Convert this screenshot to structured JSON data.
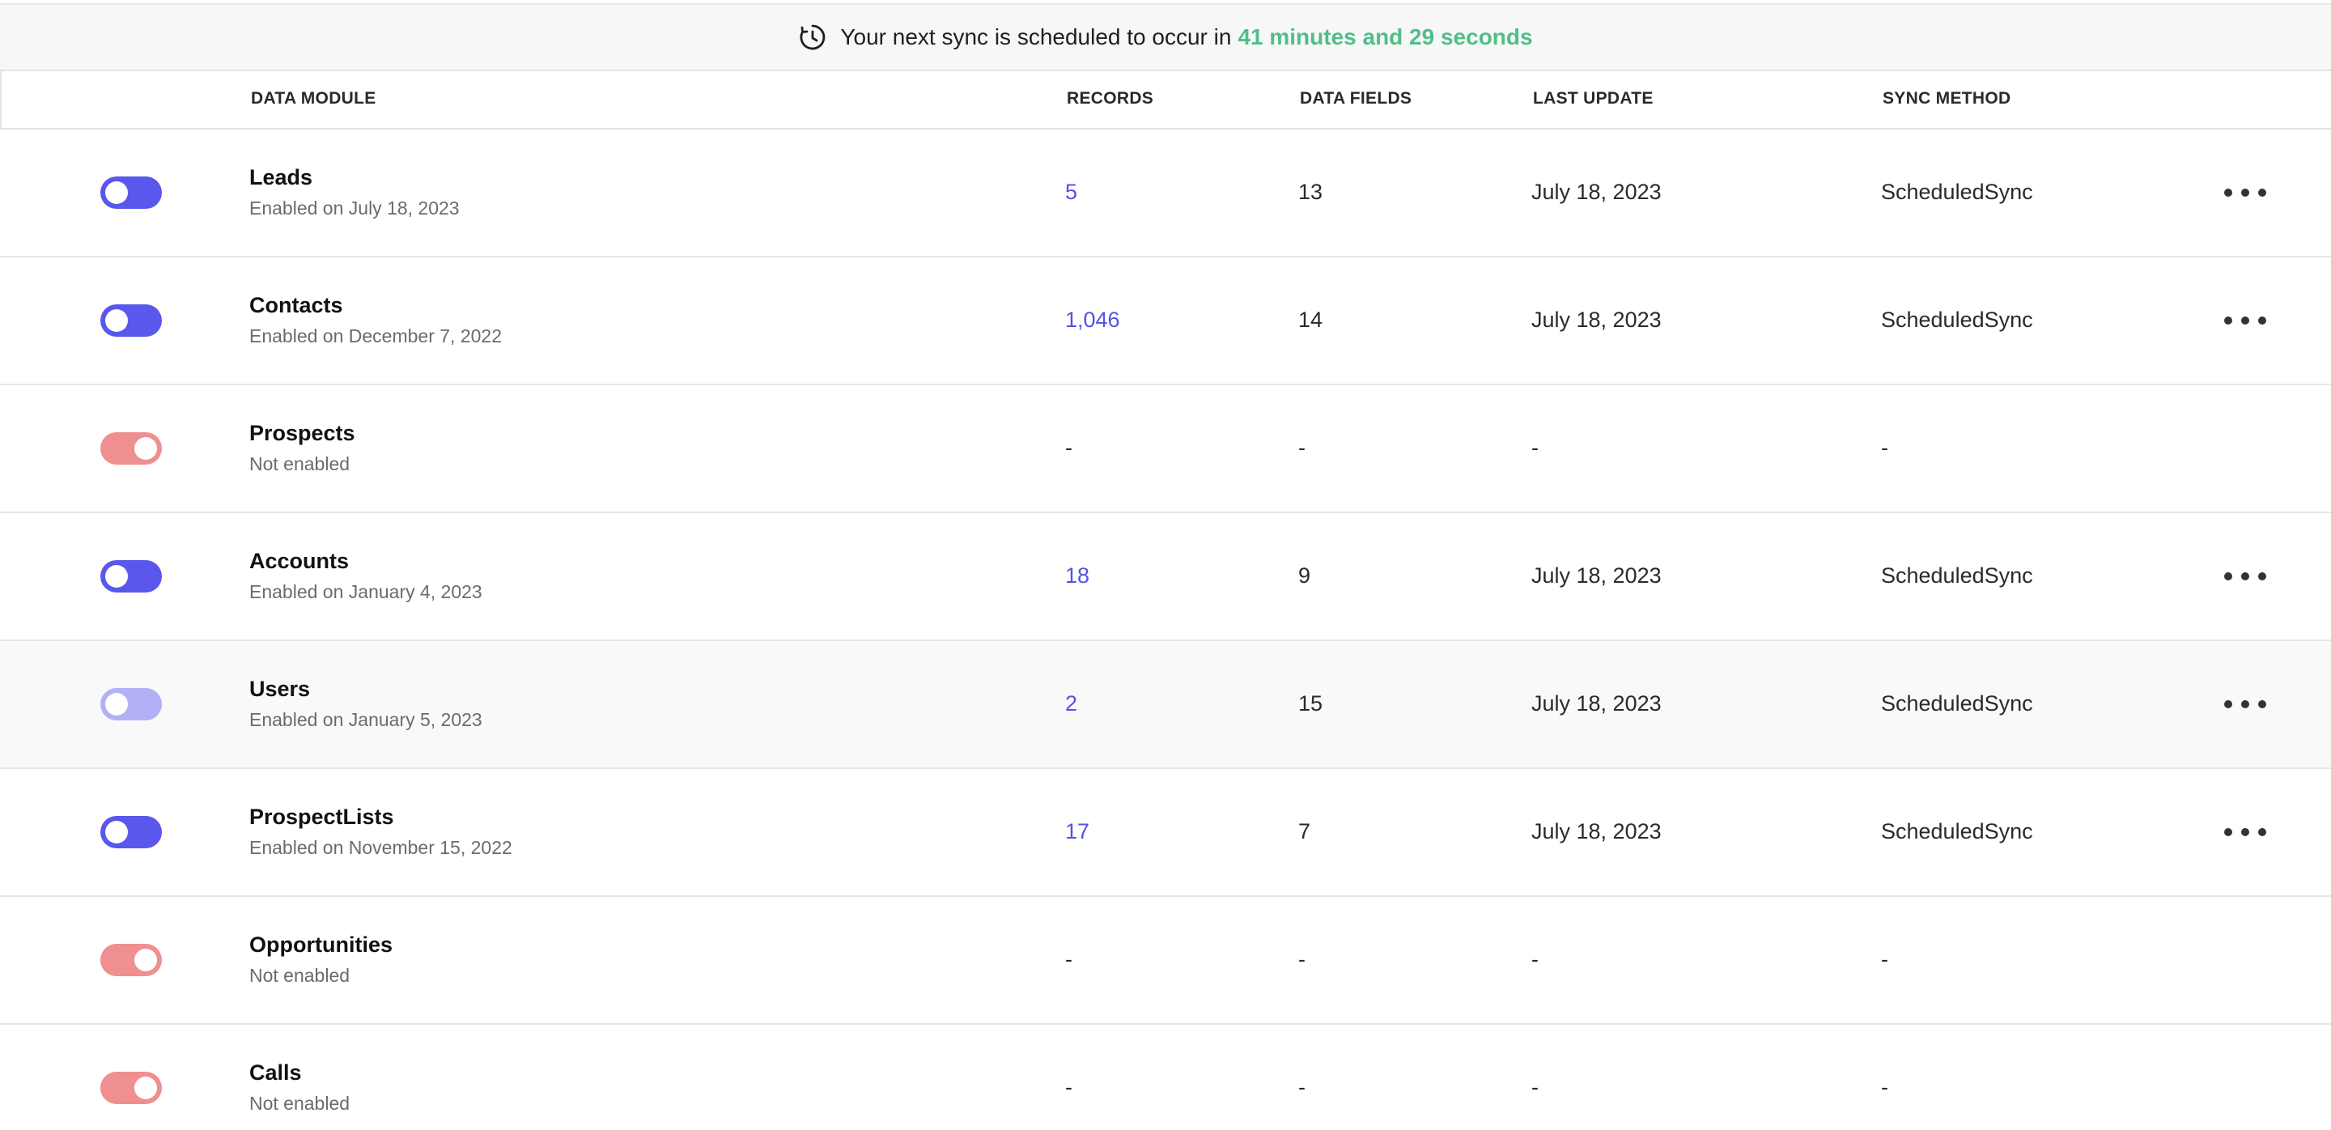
{
  "banner": {
    "text": "Your next sync is scheduled to occur in",
    "countdown": "41 minutes and 29 seconds",
    "icon": "clock-icon",
    "highlight_color": "#4fbf86"
  },
  "columns": {
    "module": "DATA MODULE",
    "records": "RECORDS",
    "fields": "DATA FIELDS",
    "update": "LAST UPDATE",
    "method": "SYNC METHOD"
  },
  "colors": {
    "toggle_on": "#5a57ec",
    "toggle_off": "#f08f8f",
    "link": "#5451e6"
  },
  "rows": [
    {
      "name": "Leads",
      "sub": "Enabled on July 18, 2023",
      "records": "5",
      "fields": "13",
      "update": "July 18, 2023",
      "method": "ScheduledSync"
    },
    {
      "name": "Contacts",
      "sub": "Enabled on December 7, 2022",
      "records": "1,046",
      "fields": "14",
      "update": "July 18, 2023",
      "method": "ScheduledSync"
    },
    {
      "name": "Prospects",
      "sub": "Not enabled",
      "records": "-",
      "fields": "-",
      "update": "-",
      "method": "-"
    },
    {
      "name": "Accounts",
      "sub": "Enabled on January 4, 2023",
      "records": "18",
      "fields": "9",
      "update": "July 18, 2023",
      "method": "ScheduledSync"
    },
    {
      "name": "Users",
      "sub": "Enabled on January 5, 2023",
      "records": "2",
      "fields": "15",
      "update": "July 18, 2023",
      "method": "ScheduledSync"
    },
    {
      "name": "ProspectLists",
      "sub": "Enabled on November 15, 2022",
      "records": "17",
      "fields": "7",
      "update": "July 18, 2023",
      "method": "ScheduledSync"
    },
    {
      "name": "Opportunities",
      "sub": "Not enabled",
      "records": "-",
      "fields": "-",
      "update": "-",
      "method": "-"
    },
    {
      "name": "Calls",
      "sub": "Not enabled",
      "records": "-",
      "fields": "-",
      "update": "-",
      "method": "-"
    }
  ]
}
